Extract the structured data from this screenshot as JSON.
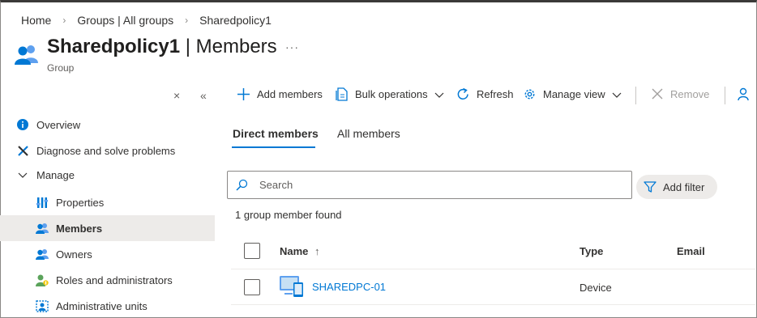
{
  "breadcrumb": {
    "home": "Home",
    "groups": "Groups | All groups",
    "current": "Sharedpolicy1"
  },
  "header": {
    "title_name": "Sharedpolicy1",
    "title_section": " | Members",
    "subtitle": "Group",
    "more": "···"
  },
  "sidebar": {
    "close_glyph": "×",
    "collapse_glyph": "«",
    "items": [
      {
        "label": "Overview",
        "icon": "info-icon"
      },
      {
        "label": "Diagnose and solve problems",
        "icon": "wrench-icon"
      },
      {
        "label": "Manage",
        "icon": "chevron-down-icon"
      },
      {
        "label": "Properties",
        "icon": "properties-icon"
      },
      {
        "label": "Members",
        "icon": "members-icon",
        "selected": true
      },
      {
        "label": "Owners",
        "icon": "owners-icon"
      },
      {
        "label": "Roles and administrators",
        "icon": "roles-icon"
      },
      {
        "label": "Administrative units",
        "icon": "admin-units-icon"
      }
    ]
  },
  "toolbar": {
    "add_members": "Add members",
    "bulk_operations": "Bulk operations",
    "refresh": "Refresh",
    "manage_view": "Manage view",
    "remove": "Remove"
  },
  "tabs": {
    "direct": "Direct members",
    "all": "All members"
  },
  "search": {
    "placeholder": "Search",
    "value": ""
  },
  "filter": {
    "label": "Add filter"
  },
  "results": {
    "count_text": "1 group member found"
  },
  "table": {
    "columns": {
      "name": "Name",
      "sort_indicator": "↑",
      "type": "Type",
      "email": "Email"
    },
    "rows": [
      {
        "name": "SHAREDPC-01",
        "type": "Device",
        "email": ""
      }
    ]
  },
  "colors": {
    "accent": "#0078d4",
    "selected_bg": "#edebe9",
    "text": "#323130",
    "muted": "#605e5c"
  }
}
